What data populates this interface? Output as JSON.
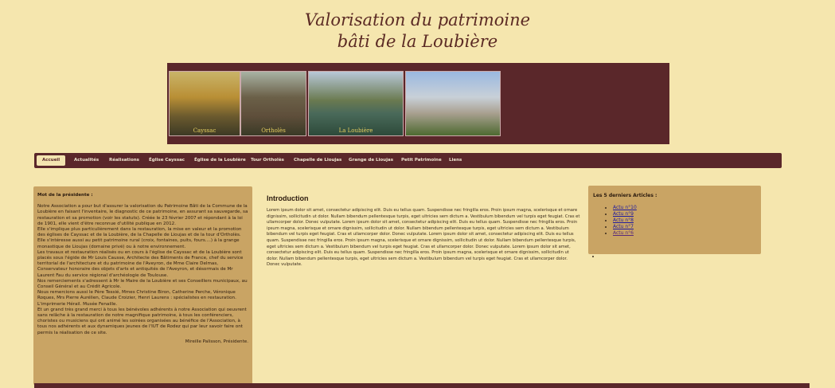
{
  "header": {
    "title_line1": "Valorisation du patrimoine",
    "title_line2": "bâti de la Loubière"
  },
  "banner": {
    "photos": [
      {
        "caption": "Cayssac"
      },
      {
        "caption": "Ortholès"
      },
      {
        "caption": "La Loubière"
      },
      {
        "caption": ""
      }
    ]
  },
  "nav": {
    "items": [
      "Accueil",
      "Actualités",
      "Réalisations",
      "Église Cayssac",
      "Église de la Loubière",
      "Tour Ortholès",
      "Chapelle de Lioujas",
      "Grange de Lioujas",
      "Petit Patrimoine",
      "Liens"
    ],
    "active": "Accueil"
  },
  "president": {
    "heading": "Mot de la présidente :",
    "paragraphs": [
      "Notre Association a pour but d'assurer la valorisation du Patrimoine Bâti de la Commune de la Loubière en faisant l'inventaire, le diagnostic de ce patrimoine, en assurant sa sauvegarde, sa restauration et sa promotion (voir les statuts). Créée le 23 février 2007 et répondant à la loi de 1901, elle vient d'être reconnue d'utilité publique en 2012.",
      "Elle s'implique plus particulièrement dans la restauration, la mise en valeur et la promotion des églises de Cayssac et de la Loubière, de la Chapelle de Lioujas et de la tour d'Ortholès.",
      "Elle s'intéresse aussi au petit patrimoine rural (croix, fontaines, puits, fours....) à la grange monastique de Lioujas (domaine privé) ou à notre environnement.",
      "Les travaux et restauration réalisés ou en cours à l'église de Cayssac et de la Loubière sont placés sous l'égide de Mr Louis Causse, Architecte des Bâtiments de France, chef du service territorial de l'architecture et du patrimoine de l'Aveyron, de Mme Claire Delmas, Conservateur honoraire des objets d'arts et antiquités de l'Aveyron, et désormais de Mr Laurent Fau du service régional d'archéologie de Toulouse.",
      "Nos remerciements s'adressent à Mr le Maire de la Loubière et ses Conseillers municipaux, au Conseil Général et au Crédit Agricole.",
      "Nous remercions aussi le Père Tessié, Mmes Christine Biron, Catherine Perche, Véronique Roques, Mrs Pierre Aurélien, Claude Croizier, Henri Laurens : spécialistes en restauration. L'imprimerie Hérail. Musée Fenaille.",
      "Et un grand très grand merci à tous les bénévoles adhérents à notre Association qui oeuvrent sans relâche à la restauration de notre magnifique patrimoine, à tous les conférenciers, choristes ou musiciens qui ont animé les soirées organisées au bénéfice de l'Association, à tous nos adhérents et aux dynamiques jeunes de l'IUT de Rodez qui par leur savoir faire ont permis la réalisation de ce site."
    ],
    "signature": "Mireille Palisson, Présidente."
  },
  "main": {
    "heading": "Introduction",
    "body": "Lorem ipsum dolor sit amet, consectetur adipiscing elit. Duis eu tellus quam. Suspendisse nec fringilla eros. Proin ipsum magna, scelerisque et ornare dignissim, sollicitudin ut dolor. Nullam bibendum pellentesque turpis, eget ultricies sem dictum a. Vestibulum bibendum vel turpis eget feugiat. Cras et ullamcorper dolor. Donec vulputate. Lorem ipsum dolor sit amet, consectetur adipiscing elit. Duis eu tellus quam. Suspendisse nec fringilla eros. Proin ipsum magna, scelerisque et ornare dignissim, sollicitudin ut dolor. Nullam bibendum pellentesque turpis, eget ultricies sem dictum a. Vestibulum bibendum vel turpis eget feugiat. Cras et ullamcorper dolor. Donec vulputate. Lorem ipsum dolor sit amet, consectetur adipiscing elit. Duis eu tellus quam. Suspendisse nec fringilla eros. Proin ipsum magna, scelerisque et ornare dignissim, sollicitudin ut dolor. Nullam bibendum pellentesque turpis, eget ultricies sem dictum a. Vestibulum bibendum vel turpis eget feugiat. Cras et ullamcorper dolor. Donec vulputate. Lorem ipsum dolor sit amet, consectetur adipiscing elit. Duis eu tellus quam. Suspendisse nec fringilla eros. Proin ipsum magna, scelerisque et ornare dignissim, sollicitudin ut dolor. Nullam bibendum pellentesque turpis, eget ultricies sem dictum a. Vestibulum bibendum vel turpis eget feugiat. Cras et ullamcorper dolor. Donec vulputate."
  },
  "latest": {
    "heading": "Les 5 derniers Articles :",
    "items": [
      "Actu n°10",
      "Actu n°9",
      "Actu n°8",
      "Actu n°7",
      "Actu n°6"
    ]
  },
  "colors": {
    "background": "#f5e6ae",
    "accent": "#5a272a",
    "box": "#c9a464",
    "link": "#1f1aa0"
  }
}
